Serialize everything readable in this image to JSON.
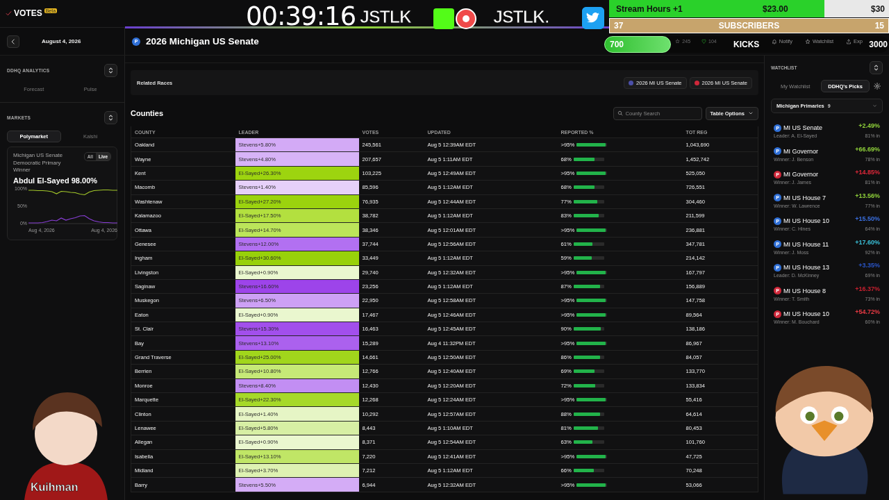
{
  "app": {
    "logo": "VOTES",
    "badge": "Beta",
    "date": "August 4, 2026",
    "race": {
      "party": {
        "label": "P",
        "color": "#2f6fd6"
      },
      "title": "2026 Michigan US Senate"
    },
    "header_stats": [
      {
        "kind": "ps",
        "value": "245"
      },
      {
        "kind": "heart",
        "value": "104"
      }
    ],
    "header_actions": [
      {
        "kind": "bell",
        "label": "Notify"
      },
      {
        "kind": "star",
        "label": "Watchlist"
      },
      {
        "kind": "export",
        "label": "Exp"
      }
    ]
  },
  "analytics": {
    "title": "DDHQ ANALYTICS",
    "tabs": [
      {
        "label": "Forecast",
        "selected": false
      },
      {
        "label": "Pulse",
        "selected": false
      }
    ]
  },
  "markets": {
    "title": "MARKETS",
    "tabs": [
      {
        "label": "Polymarket",
        "selected": true
      },
      {
        "label": "Kalshi",
        "selected": false
      }
    ],
    "card": {
      "title": "Michigan US Senate Democratic Primary Winner",
      "range_tabs": [
        {
          "label": "All",
          "selected": false
        },
        {
          "label": "Live",
          "selected": true
        }
      ],
      "headline": "Abdul El-Sayed 98.00%",
      "x_axis_labels": [
        "Aug 4, 2026",
        "Aug 4, 2026"
      ],
      "chart_data": {
        "type": "line",
        "ylim": [
          0,
          100
        ],
        "yticks": [
          {
            "value": 0,
            "label": "0%"
          },
          {
            "value": 50,
            "label": "50%"
          },
          {
            "value": 100,
            "label": "100%"
          }
        ],
        "series": [
          {
            "color": "#a4c92a",
            "values": [
              96,
              96,
              95,
              95,
              94,
              92,
              86,
              93,
              92,
              90,
              89,
              85,
              83,
              91,
              95,
              96,
              97,
              97,
              96,
              96
            ]
          },
          {
            "color": "#8a3fd8",
            "values": [
              2,
              2,
              2,
              3,
              6,
              10,
              8,
              16,
              10,
              14,
              17,
              22,
              23,
              14,
              8,
              5,
              3,
              3,
              2,
              2
            ]
          }
        ]
      }
    }
  },
  "related_races": {
    "label": "Related Races",
    "chips": [
      {
        "label": "2026 MI US Senate",
        "color": "#4b4fa8"
      },
      {
        "label": "2026 MI US Senate",
        "color": "#d0283a"
      }
    ]
  },
  "counties": {
    "title": "Counties",
    "search": {
      "placeholder": "County Search"
    },
    "options_button": "Table Options",
    "columns": [
      "COUNTY",
      "LEADER",
      "VOTES",
      "UPDATED",
      "REPORTED %",
      "TOT REG"
    ],
    "rows": [
      {
        "county": "Oakland",
        "leader": "Stevens+5.80%",
        "color": "#d3aaf6",
        "votes": "245,561",
        "updated": "Aug 5 12:39AM EDT",
        "reported": ">95%",
        "level": 0.95,
        "tot_reg": "1,043,690"
      },
      {
        "county": "Wayne",
        "leader": "Stevens+4.80%",
        "color": "#d7b3f7",
        "votes": "207,657",
        "updated": "Aug 5 1:11AM EDT",
        "reported": "68%",
        "level": 0.68,
        "tot_reg": "1,452,742"
      },
      {
        "county": "Kent",
        "leader": "El-Sayed+26.30%",
        "color": "#9dd40f",
        "votes": "103,225",
        "updated": "Aug 5 12:49AM EDT",
        "reported": ">95%",
        "level": 0.95,
        "tot_reg": "525,050"
      },
      {
        "county": "Macomb",
        "leader": "Stevens+1.40%",
        "color": "#e6d0fa",
        "votes": "85,596",
        "updated": "Aug 5 1:12AM EDT",
        "reported": "68%",
        "level": 0.68,
        "tot_reg": "726,551"
      },
      {
        "county": "Washtenaw",
        "leader": "El-Sayed+27.20%",
        "color": "#9bd30e",
        "votes": "76,935",
        "updated": "Aug 5 12:44AM EDT",
        "reported": "77%",
        "level": 0.77,
        "tot_reg": "304,460"
      },
      {
        "county": "Kalamazoo",
        "leader": "El-Sayed+17.50%",
        "color": "#b3e03f",
        "votes": "38,782",
        "updated": "Aug 5 1:12AM EDT",
        "reported": "83%",
        "level": 0.83,
        "tot_reg": "211,599"
      },
      {
        "county": "Ottawa",
        "leader": "El-Sayed+14.70%",
        "color": "#bce55a",
        "votes": "38,346",
        "updated": "Aug 5 12:01AM EDT",
        "reported": ">95%",
        "level": 0.95,
        "tot_reg": "236,881"
      },
      {
        "county": "Genesee",
        "leader": "Stevens+12.00%",
        "color": "#b270f1",
        "votes": "37,744",
        "updated": "Aug 5 12:56AM EDT",
        "reported": "61%",
        "level": 0.61,
        "tot_reg": "347,781"
      },
      {
        "county": "Ingham",
        "leader": "El-Sayed+30.60%",
        "color": "#98d10a",
        "votes": "33,449",
        "updated": "Aug 5 1:12AM EDT",
        "reported": "59%",
        "level": 0.59,
        "tot_reg": "214,142"
      },
      {
        "county": "Livingston",
        "leader": "El-Sayed+0.90%",
        "color": "#eaf7cf",
        "votes": "29,740",
        "updated": "Aug 5 12:32AM EDT",
        "reported": ">95%",
        "level": 0.95,
        "tot_reg": "167,797"
      },
      {
        "county": "Saginaw",
        "leader": "Stevens+16.60%",
        "color": "#9d44ea",
        "votes": "23,256",
        "updated": "Aug 5 1:12AM EDT",
        "reported": "87%",
        "level": 0.87,
        "tot_reg": "156,889"
      },
      {
        "county": "Muskegon",
        "leader": "Stevens+6.50%",
        "color": "#cda0f5",
        "votes": "22,950",
        "updated": "Aug 5 12:58AM EDT",
        "reported": ">95%",
        "level": 0.95,
        "tot_reg": "147,758"
      },
      {
        "county": "Eaton",
        "leader": "El-Sayed+0.90%",
        "color": "#eaf7cf",
        "votes": "17,467",
        "updated": "Aug 5 12:46AM EDT",
        "reported": ">95%",
        "level": 0.95,
        "tot_reg": "89,564"
      },
      {
        "county": "St. Clair",
        "leader": "Stevens+15.30%",
        "color": "#a24fec",
        "votes": "16,463",
        "updated": "Aug 5 12:45AM EDT",
        "reported": "90%",
        "level": 0.9,
        "tot_reg": "138,186"
      },
      {
        "county": "Bay",
        "leader": "Stevens+13.10%",
        "color": "#ab61ee",
        "votes": "15,289",
        "updated": "Aug 4 11:32PM EDT",
        "reported": ">95%",
        "level": 0.95,
        "tot_reg": "86,967"
      },
      {
        "county": "Grand Traverse",
        "leader": "El-Sayed+25.00%",
        "color": "#a1d61c",
        "votes": "14,661",
        "updated": "Aug 5 12:50AM EDT",
        "reported": "86%",
        "level": 0.86,
        "tot_reg": "84,057"
      },
      {
        "county": "Berrien",
        "leader": "El-Sayed+10.80%",
        "color": "#c6e977",
        "votes": "12,766",
        "updated": "Aug 5 12:40AM EDT",
        "reported": "69%",
        "level": 0.69,
        "tot_reg": "133,770"
      },
      {
        "county": "Monroe",
        "leader": "Stevens+8.40%",
        "color": "#c28ef3",
        "votes": "12,430",
        "updated": "Aug 5 12:20AM EDT",
        "reported": "72%",
        "level": 0.72,
        "tot_reg": "133,834"
      },
      {
        "county": "Marquette",
        "leader": "El-Sayed+22.30%",
        "color": "#a6d929",
        "votes": "12,268",
        "updated": "Aug 5 12:24AM EDT",
        "reported": ">95%",
        "level": 0.95,
        "tot_reg": "55,416"
      },
      {
        "county": "Clinton",
        "leader": "El-Sayed+1.40%",
        "color": "#e6f5c5",
        "votes": "10,292",
        "updated": "Aug 5 12:57AM EDT",
        "reported": "88%",
        "level": 0.88,
        "tot_reg": "64,614"
      },
      {
        "county": "Lenawee",
        "leader": "El-Sayed+5.80%",
        "color": "#d7efa4",
        "votes": "8,443",
        "updated": "Aug 5 1:10AM EDT",
        "reported": "81%",
        "level": 0.81,
        "tot_reg": "80,453"
      },
      {
        "county": "Allegan",
        "leader": "El-Sayed+0.90%",
        "color": "#eaf7cf",
        "votes": "8,371",
        "updated": "Aug 5 12:54AM EDT",
        "reported": "63%",
        "level": 0.63,
        "tot_reg": "101,760"
      },
      {
        "county": "Isabella",
        "leader": "El-Sayed+13.10%",
        "color": "#c0e666",
        "votes": "7,220",
        "updated": "Aug 5 12:41AM EDT",
        "reported": ">95%",
        "level": 0.95,
        "tot_reg": "47,725"
      },
      {
        "county": "Midland",
        "leader": "El-Sayed+3.70%",
        "color": "#def2b2",
        "votes": "7,212",
        "updated": "Aug 5 1:12AM EDT",
        "reported": "66%",
        "level": 0.66,
        "tot_reg": "70,248"
      },
      {
        "county": "Barry",
        "leader": "Stevens+5.50%",
        "color": "#d4acf6",
        "votes": "6,944",
        "updated": "Aug 5 12:32AM EDT",
        "reported": ">95%",
        "level": 0.95,
        "tot_reg": "53,066"
      }
    ]
  },
  "watchlist": {
    "title": "WATCHLIST",
    "tabs": [
      {
        "label": "My Watchlist",
        "selected": false
      },
      {
        "label": "DDHQ's Picks",
        "selected": true
      }
    ],
    "filter": {
      "label": "Michigan Primaries",
      "count": "9"
    },
    "items": [
      {
        "party": {
          "label": "P",
          "color": "#2f6fd6"
        },
        "name": "MI US Senate",
        "detail": "Leader: A. El-Sayed",
        "change": "+2.49%",
        "color": "#8fd13a",
        "reported": "81% in"
      },
      {
        "party": {
          "label": "P",
          "color": "#2f6fd6"
        },
        "name": "MI Governor",
        "detail": "Winner: J. Benson",
        "change": "+66.69%",
        "color": "#8fd13a",
        "reported": "78% in"
      },
      {
        "party": {
          "label": "P",
          "color": "#d0283a"
        },
        "name": "MI Governor",
        "detail": "Winner: J. James",
        "change": "+14.85%",
        "color": "#e0283a",
        "reported": "81% in"
      },
      {
        "party": {
          "label": "P",
          "color": "#2f6fd6"
        },
        "name": "MI US House 7",
        "detail": "Winner: W. Lawrence",
        "change": "+13.56%",
        "color": "#8fd13a",
        "reported": "77% in"
      },
      {
        "party": {
          "label": "P",
          "color": "#2f6fd6"
        },
        "name": "MI US House 10",
        "detail": "Winner: C. Hines",
        "change": "+15.50%",
        "color": "#3a6fe0",
        "reported": "64% in"
      },
      {
        "party": {
          "label": "P",
          "color": "#2f6fd6"
        },
        "name": "MI US House 11",
        "detail": "Winner: J. Moss",
        "change": "+17.60%",
        "color": "#3ac0d8",
        "reported": "92% in"
      },
      {
        "party": {
          "label": "P",
          "color": "#2f6fd6"
        },
        "name": "MI US House 13",
        "detail": "Leader: D. McKinney",
        "change": "+3.35%",
        "color": "#2a55c8",
        "reported": "69% in"
      },
      {
        "party": {
          "label": "P",
          "color": "#d0283a"
        },
        "name": "MI US House 8",
        "detail": "Winner: T. Smith",
        "change": "+16.37%",
        "color": "#c8202f",
        "reported": "73% in"
      },
      {
        "party": {
          "label": "P",
          "color": "#d0283a"
        },
        "name": "MI US House 10",
        "detail": "Winner: M. Bouchard",
        "change": "+54.72%",
        "color": "#ea3a44",
        "reported": "60% in"
      }
    ]
  },
  "stream_overlay": {
    "timer": "00:39:16",
    "logos": [
      "JSTLK",
      "JSTLK."
    ],
    "stream_hours": {
      "label": "Stream Hours +1",
      "value": "$23.00",
      "goal": "$30",
      "level": 0.77
    },
    "subscribers": {
      "current": "37",
      "label": "SUBSCRIBERS",
      "goal": "15"
    },
    "kicks": {
      "current": "700",
      "label": "KICKS",
      "goal": "3000",
      "level": 0.23
    },
    "streamer": "Kuihman"
  }
}
